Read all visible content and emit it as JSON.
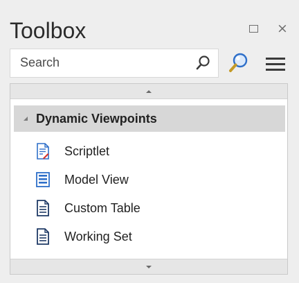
{
  "window": {
    "title": "Toolbox",
    "restore_icon": "restore-window-icon",
    "close_icon": "close-icon",
    "close_glyph": "×"
  },
  "search": {
    "placeholder": "Search",
    "icon": "search-icon"
  },
  "toolbar": {
    "find_icon": "magnifier-find-icon",
    "menu_icon": "hamburger-menu-icon"
  },
  "group": {
    "title": "Dynamic Viewpoints",
    "expanded": true,
    "items": [
      {
        "label": "Scriptlet",
        "icon": "scriptlet-icon"
      },
      {
        "label": "Model View",
        "icon": "model-view-icon"
      },
      {
        "label": "Custom Table",
        "icon": "custom-table-icon"
      },
      {
        "label": "Working Set",
        "icon": "working-set-icon"
      }
    ]
  },
  "colors": {
    "panel_bg": "#eeeeee",
    "header_bg": "#d7d7d7",
    "accent_blue": "#2e6fc9",
    "accent_red": "#d9312b"
  }
}
